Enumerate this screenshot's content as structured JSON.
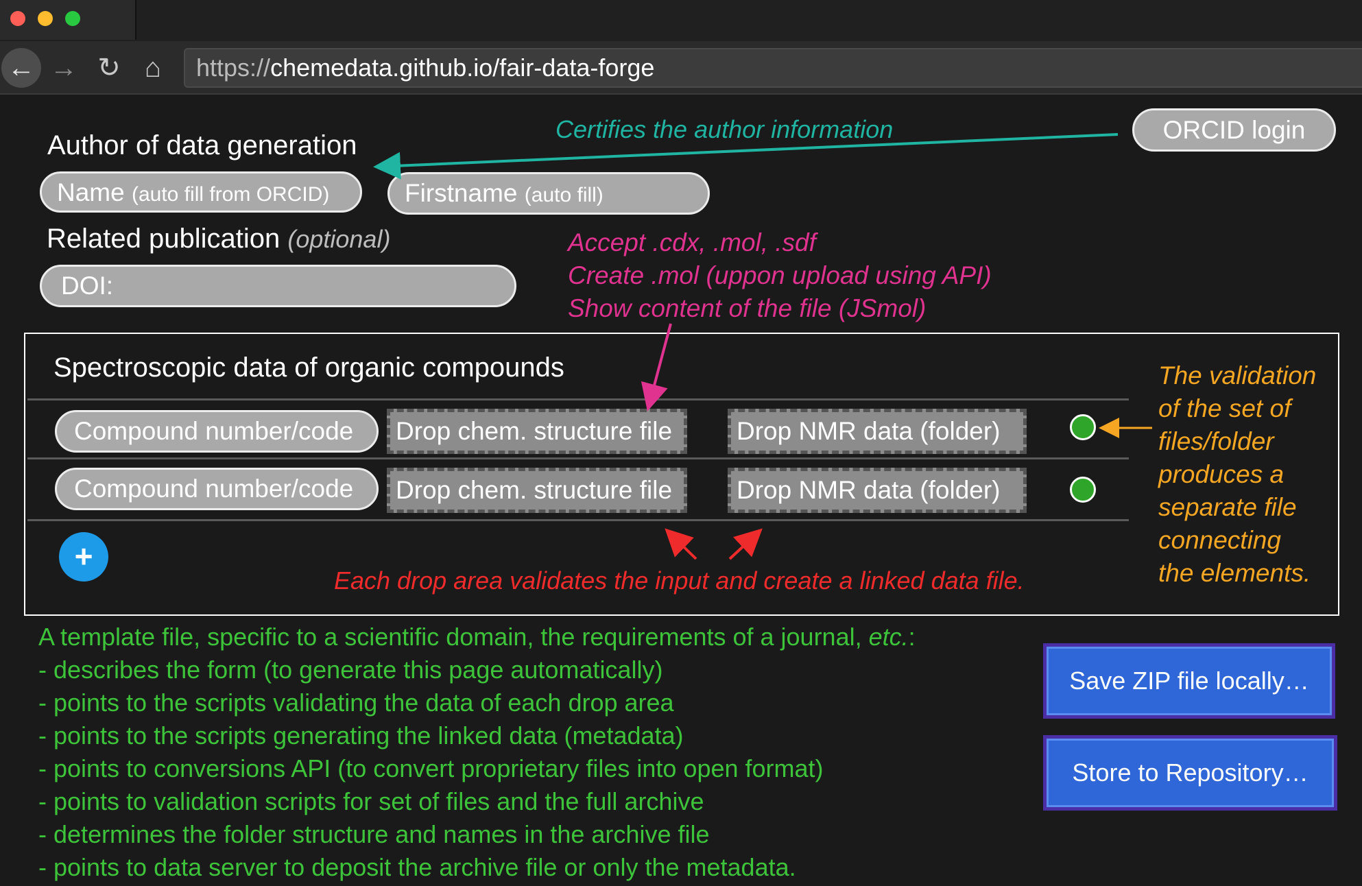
{
  "browser": {
    "url_scheme": "https://",
    "url_host_path": "chemedata.github.io/fair-data-forge",
    "nav": {
      "back": "←",
      "forward": "→",
      "reload": "↻",
      "home": "⌂"
    }
  },
  "author": {
    "heading": "Author of data generation",
    "name_label": "Name",
    "name_hint": "(auto fill from ORCID)",
    "firstname_label": "Firstname",
    "firstname_hint": "(auto fill)",
    "orcid_button": "ORCID login"
  },
  "publication": {
    "heading": "Related publication",
    "optional": "(optional)",
    "doi_label": "DOI:"
  },
  "panel": {
    "title": "Spectroscopic data of organic compounds",
    "rows": [
      {
        "compound": "Compound number/code",
        "structure_drop": "Drop chem. structure file",
        "nmr_drop": "Drop NMR data (folder)"
      },
      {
        "compound": "Compound number/code",
        "structure_drop": "Drop chem. structure file",
        "nmr_drop": "Drop NMR data (folder)"
      }
    ],
    "add_button": "+"
  },
  "annotations": {
    "orcid": "Certifies the author information",
    "structure": [
      "Accept .cdx, .mol, .sdf",
      "Create .mol (uppon upload using API)",
      "Show content of the file (JSmol)"
    ],
    "drop_areas": "Each drop area validates the input and create a linked data file.",
    "validation": [
      "The validation",
      "of the set of",
      "files/folder",
      "produces a",
      "separate file",
      "connecting",
      "the elements."
    ]
  },
  "template_note": {
    "intro": "A template file, specific to a scientific domain, the requirements of a journal, ",
    "intro_etc": "etc.",
    "intro_end": ":",
    "items": [
      "- describes the form (to generate this page automatically)",
      "- points to the scripts validating the data of each drop area",
      "- points to the scripts generating the linked data (metadata)",
      "- points to conversions API (to convert proprietary files into open format)",
      "- points to validation scripts for set of files and the full archive",
      "- determines the folder structure and names in the archive file",
      "- points to data server to deposit the archive file or only the metadata."
    ]
  },
  "actions": {
    "save_zip": "Save ZIP file locally…",
    "store_repo": "Store to Repository…"
  },
  "colors": {
    "teal": "#1fb5a2",
    "pink": "#e0338f",
    "red": "#ef2b2b",
    "orange": "#f5a623",
    "green": "#3dc43a",
    "status_ok": "#2fa52a",
    "accent_blue": "#1e9be8"
  },
  "icons": [
    "back-arrow-icon",
    "forward-arrow-icon",
    "reload-icon",
    "home-icon",
    "plus-icon",
    "status-ok-icon"
  ]
}
